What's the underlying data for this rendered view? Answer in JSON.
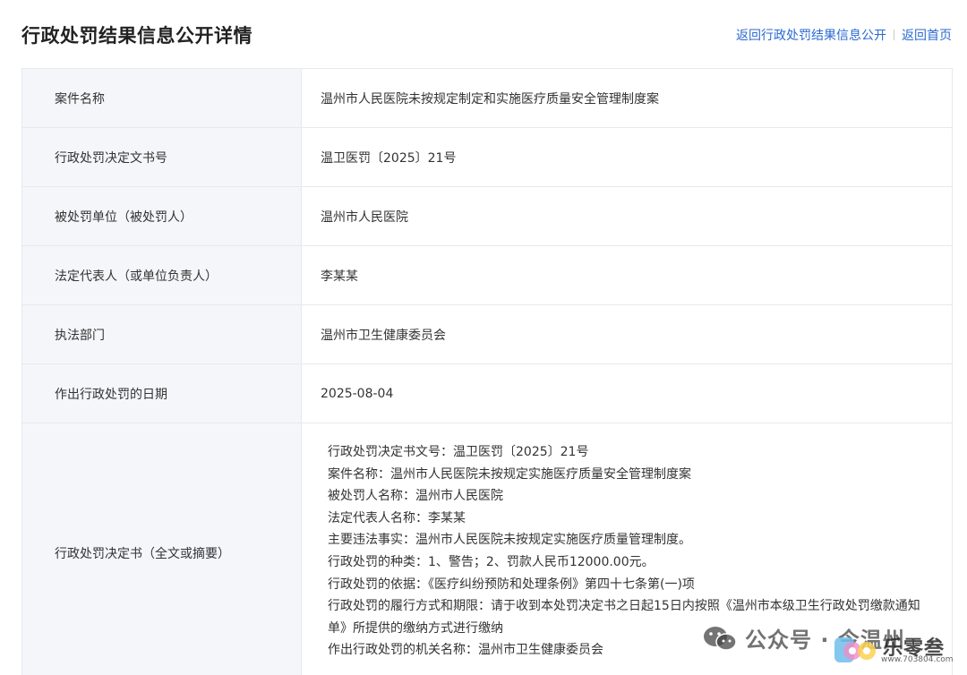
{
  "header": {
    "title": "行政处罚结果信息公开详情",
    "links": {
      "back_to_list": "返回行政处罚结果信息公开",
      "back_home": "返回首页"
    }
  },
  "rows": [
    {
      "label": "案件名称",
      "value": "温州市人民医院未按规定制定和实施医疗质量安全管理制度案"
    },
    {
      "label": "行政处罚决定文书号",
      "value": "温卫医罚〔2025〕21号"
    },
    {
      "label": "被处罚单位（被处罚人）",
      "value": "温州市人民医院"
    },
    {
      "label": "法定代表人（或单位负责人）",
      "value": "李某某"
    },
    {
      "label": "执法部门",
      "value": "温州市卫生健康委员会"
    },
    {
      "label": "作出行政处罚的日期",
      "value": "2025-08-04"
    }
  ],
  "decision": {
    "label": "行政处罚决定书（全文或摘要）",
    "lines": [
      "行政处罚决定书文号：温卫医罚〔2025〕21号",
      "案件名称：温州市人民医院未按规定实施医疗质量安全管理制度案",
      "被处罚人名称：温州市人民医院",
      "法定代表人名称：李某某",
      "主要违法事实：温州市人民医院未按规定实施医疗质量管理制度。",
      "行政处罚的种类：1、警告；2、罚款人民币12000.00元。",
      "行政处罚的依据：《医疗纠纷预防和处理条例》第四十七条第(一)项",
      "行政处罚的履行方式和期限：请于收到本处罚决定书之日起15日内按照《温州市本级卫生行政处罚缴款通知单》所提供的缴纳方式进行缴纳",
      "作出行政处罚的机关名称：温州市卫生健康委员会"
    ]
  },
  "watermark": {
    "account_text": "公众号 · 今温州",
    "logo_text": "乐零叁",
    "url": "www.703804.com"
  }
}
